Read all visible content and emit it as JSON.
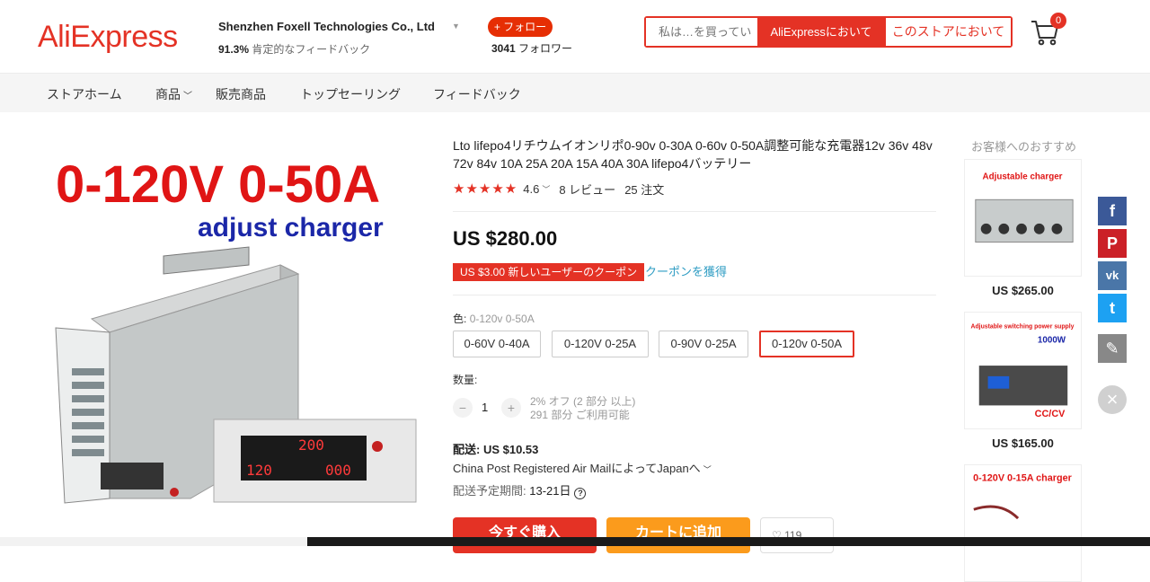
{
  "header": {
    "logo": "AliExpress",
    "store_name": "Shenzhen Foxell Technologies Co., Ltd",
    "feedback_pct": "91.3%",
    "feedback_text": " 肯定的なフィードバック",
    "follow_label": "+ フォロー",
    "followers_count": "3041",
    "followers_text": " フォロワー",
    "search_placeholder": "私は…を買ってい",
    "search_ali_label": "AliExpressにおいて",
    "search_store_label": "このストアにおいて",
    "cart_count": "0"
  },
  "nav": {
    "items": [
      "ストアホーム",
      "商品",
      "販売商品",
      "トップセーリング",
      "フィードバック"
    ]
  },
  "product": {
    "image_text_main": "0-120V 0-50A",
    "image_text_sub": "adjust charger",
    "image_display_top": "200",
    "image_display_bottom": "120",
    "image_display_right": "000",
    "title": "Lto lifepo4リチウムイオンリポ0-90v 0-30A 0-60v 0-50A調整可能な充電器12v 36v 48v 72v 84v 10A 25A 20A 15A 40A 30A lifepo4バッテリー",
    "stars": "★★★★★",
    "rating": "4.6",
    "reviews": "8 レビュー",
    "orders": "25 注文",
    "price": "US $280.00",
    "coupon": "US $3.00 新しいユーザーのクーポン",
    "coupon_link": "クーポンを獲得",
    "color_label": "色:",
    "color_selected": "0-120v 0-50A",
    "skus": [
      "0-60V 0-40A",
      "0-120V 0-25A",
      "0-90V 0-25A",
      "0-120v 0-50A"
    ],
    "qty_label": "数量:",
    "qty_value": "1",
    "qty_note_1": "2% オフ (2 部分 以上)",
    "qty_note_2": "291 部分 ご利用可能",
    "ship_label": "配送: US $10.53",
    "ship_method": "China Post Registered Air MailによってJapanへ",
    "ship_date_label": "配送予定期間: ",
    "ship_date_value": "13-21日",
    "buy_label": "今すぐ購入",
    "cart_label": "カートに追加",
    "wish_count": "119"
  },
  "recommend": {
    "title": "お客様へのおすすめ",
    "items": [
      {
        "price": "US $265.00",
        "image_title": "Adjustable charger"
      },
      {
        "price": "US $165.00",
        "image_title": "Adjustable switching power supply",
        "image_badge": "1000W",
        "image_tag": "CC/CV"
      },
      {
        "image_title": "0-120V 0-15A charger"
      }
    ]
  },
  "colors": {
    "accent": "#e43225",
    "orange": "#fb9b1c",
    "link": "#2e9cc3",
    "facebook": "#3b5998",
    "pinterest": "#cb2027",
    "vk": "#4a76a8",
    "twitter": "#1da1f2",
    "edit": "#888888"
  },
  "share_icons": [
    "facebook-icon",
    "pinterest-icon",
    "vk-icon",
    "twitter-icon",
    "edit-icon",
    "close-icon"
  ]
}
